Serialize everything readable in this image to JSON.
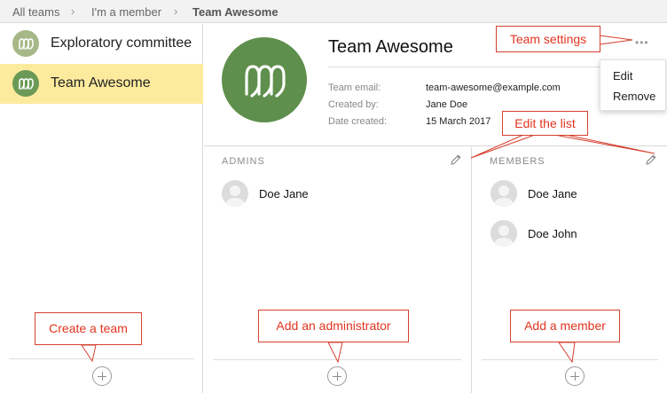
{
  "breadcrumb": {
    "items": [
      "All teams",
      "I'm a member",
      "Team Awesome"
    ],
    "separator": "›"
  },
  "sidebar": {
    "teams": [
      {
        "name": "Exploratory committee",
        "selected": false
      },
      {
        "name": "Team Awesome",
        "selected": true
      }
    ],
    "selected_color": "#fdeb9d"
  },
  "team": {
    "title": "Team Awesome",
    "avatar_color": "#5e8f4c",
    "details": [
      {
        "label": "Team email:",
        "value": "team-awesome@example.com"
      },
      {
        "label": "Created by:",
        "value": "Jane Doe"
      },
      {
        "label": "Date created:",
        "value": "15 March 2017"
      }
    ],
    "more_icon": "•••"
  },
  "settings_menu": {
    "items": [
      "Edit",
      "Remove"
    ]
  },
  "admins": {
    "heading": "ADMINS",
    "people": [
      "Doe Jane"
    ]
  },
  "members": {
    "heading": "MEMBERS",
    "people": [
      "Doe Jane",
      "Doe John"
    ]
  },
  "callouts": {
    "team_settings": "Team settings",
    "edit_list": "Edit the list",
    "create_team": "Create a team",
    "add_admin": "Add an administrator",
    "add_member": "Add a member"
  },
  "colors": {
    "callout": "#e2341f"
  }
}
